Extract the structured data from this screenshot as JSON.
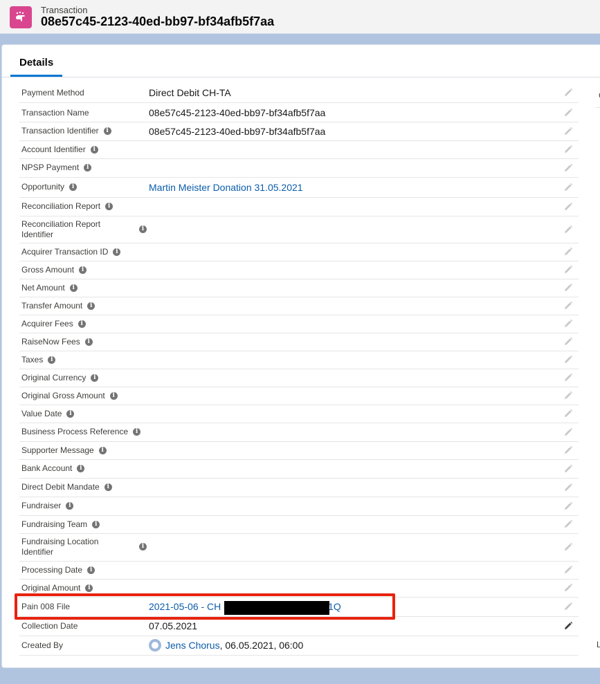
{
  "header": {
    "object_type": "Transaction",
    "record_title": "08e57c45-2123-40ed-bb97-bf34afb5f7aa"
  },
  "tabs": [
    {
      "label": "Details"
    }
  ],
  "right_column_fragments": {
    "top": "C",
    "bottom": "L"
  },
  "fields": [
    {
      "label": "Payment Method",
      "value": "Direct Debit CH-TA",
      "info": false,
      "link": false
    },
    {
      "label": "Transaction Name",
      "value": "08e57c45-2123-40ed-bb97-bf34afb5f7aa",
      "info": false,
      "link": false
    },
    {
      "label": "Transaction Identifier",
      "value": "08e57c45-2123-40ed-bb97-bf34afb5f7aa",
      "info": true,
      "link": false
    },
    {
      "label": "Account Identifier",
      "value": "",
      "info": true,
      "link": false
    },
    {
      "label": "NPSP Payment",
      "value": "",
      "info": true,
      "link": false
    },
    {
      "label": "Opportunity",
      "value": "Martin Meister Donation 31.05.2021",
      "info": true,
      "link": true
    },
    {
      "label": "Reconciliation Report",
      "value": "",
      "info": true,
      "link": false
    },
    {
      "label": "Reconciliation Report Identifier",
      "value": "",
      "info": true,
      "link": false
    },
    {
      "label": "Acquirer Transaction ID",
      "value": "",
      "info": true,
      "link": false
    },
    {
      "label": "Gross Amount",
      "value": "",
      "info": true,
      "link": false
    },
    {
      "label": "Net Amount",
      "value": "",
      "info": true,
      "link": false
    },
    {
      "label": "Transfer Amount",
      "value": "",
      "info": true,
      "link": false
    },
    {
      "label": "Acquirer Fees",
      "value": "",
      "info": true,
      "link": false
    },
    {
      "label": "RaiseNow Fees",
      "value": "",
      "info": true,
      "link": false
    },
    {
      "label": "Taxes",
      "value": "",
      "info": true,
      "link": false
    },
    {
      "label": "Original Currency",
      "value": "",
      "info": true,
      "link": false
    },
    {
      "label": "Original Gross Amount",
      "value": "",
      "info": true,
      "link": false
    },
    {
      "label": "Value Date",
      "value": "",
      "info": true,
      "link": false
    },
    {
      "label": "Business Process Reference",
      "value": "",
      "info": true,
      "link": false
    },
    {
      "label": "Supporter Message",
      "value": "",
      "info": true,
      "link": false
    },
    {
      "label": "Bank Account",
      "value": "",
      "info": true,
      "link": false
    },
    {
      "label": "Direct Debit Mandate",
      "value": "",
      "info": true,
      "link": false
    },
    {
      "label": "Fundraiser",
      "value": "",
      "info": true,
      "link": false
    },
    {
      "label": "Fundraising Team",
      "value": "",
      "info": true,
      "link": false
    },
    {
      "label": "Fundraising Location Identifier",
      "value": "",
      "info": true,
      "link": false
    },
    {
      "label": "Processing Date",
      "value": "",
      "info": true,
      "link": false
    },
    {
      "label": "Original Amount",
      "value": "",
      "info": true,
      "link": false
    },
    {
      "label": "Pain 008 File",
      "value": "2021-05-06 - CH",
      "value_suffix": "01Q",
      "info": false,
      "link": true
    },
    {
      "label": "Collection Date",
      "value": "07.05.2021",
      "info": false,
      "link": false
    },
    {
      "label": "Created By",
      "value": "Jens Chorus",
      "value_suffix": ", 06.05.2021, 06:00",
      "info": false,
      "link": true
    }
  ],
  "colors": {
    "brand_icon": "#d9468f",
    "link": "#0b5cab",
    "tab_accent": "#0176d3",
    "highlight_box": "#e8230f"
  }
}
